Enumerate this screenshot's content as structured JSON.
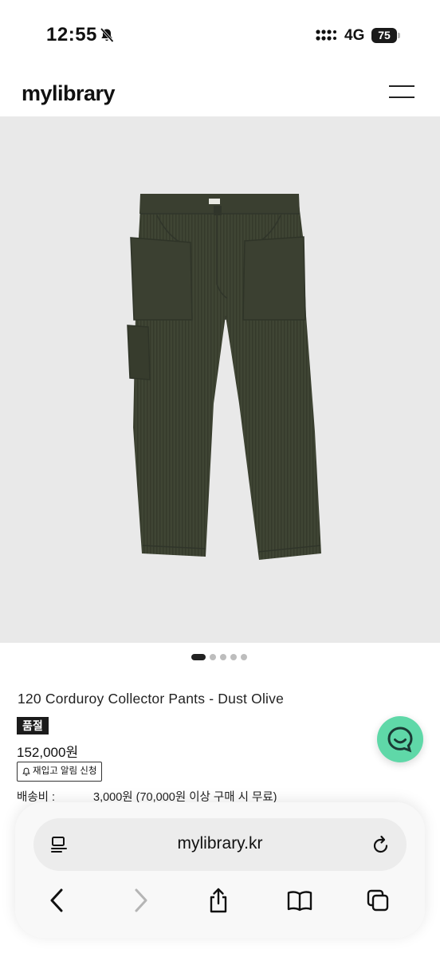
{
  "status_bar": {
    "time": "12:55",
    "network": "4G",
    "battery": "75"
  },
  "header": {
    "logo": "mylibrary"
  },
  "product": {
    "title": "120 Corduroy Collector Pants - Dust Olive",
    "soldout_badge": "품절",
    "price": "152,000원",
    "restock_label": "재입고 알림 신청",
    "shipping_label": "배송비 :",
    "shipping_value": "3,000원 (70,000원 이상 구매 시 무료)",
    "image_count": 5,
    "active_image_index": 0,
    "image_color": "#3f4534"
  },
  "browser": {
    "address": "mylibrary.kr"
  },
  "colors": {
    "chat_accent": "#5fd8a8",
    "badge_bg": "#1b1b1b"
  }
}
